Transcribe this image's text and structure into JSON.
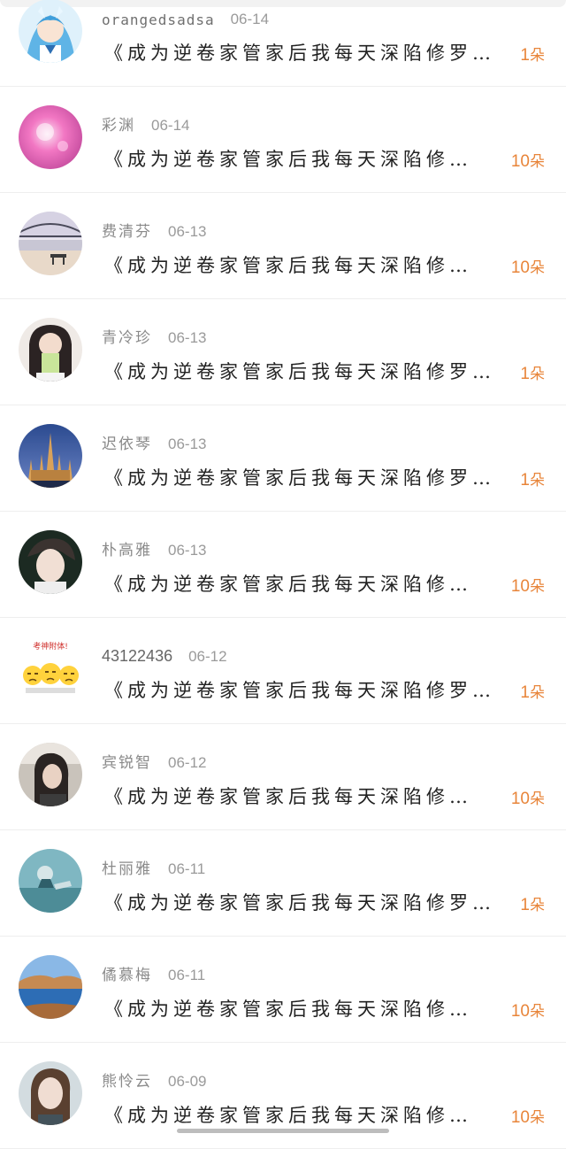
{
  "comments": [
    {
      "name": "orangedsadsa",
      "date": "06-14",
      "text": "《成为逆卷家管家后我每天深陷修罗…",
      "gift": "1",
      "unit": "朵"
    },
    {
      "name": "彩渊",
      "date": "06-14",
      "text": "《成为逆卷家管家后我每天深陷修…",
      "gift": "10",
      "unit": "朵"
    },
    {
      "name": "费清芬",
      "date": "06-13",
      "text": "《成为逆卷家管家后我每天深陷修…",
      "gift": "10",
      "unit": "朵"
    },
    {
      "name": "青冷珍",
      "date": "06-13",
      "text": "《成为逆卷家管家后我每天深陷修罗…",
      "gift": "1",
      "unit": "朵"
    },
    {
      "name": "迟依琴",
      "date": "06-13",
      "text": "《成为逆卷家管家后我每天深陷修罗…",
      "gift": "1",
      "unit": "朵"
    },
    {
      "name": "朴高雅",
      "date": "06-13",
      "text": "《成为逆卷家管家后我每天深陷修…",
      "gift": "10",
      "unit": "朵"
    },
    {
      "name": "43122436",
      "date": "06-12",
      "text": "《成为逆卷家管家后我每天深陷修罗…",
      "gift": "1",
      "unit": "朵",
      "avatar_caption": "考神附体!"
    },
    {
      "name": "宾锐智",
      "date": "06-12",
      "text": "《成为逆卷家管家后我每天深陷修…",
      "gift": "10",
      "unit": "朵"
    },
    {
      "name": "杜丽雅",
      "date": "06-11",
      "text": "《成为逆卷家管家后我每天深陷修罗…",
      "gift": "1",
      "unit": "朵"
    },
    {
      "name": "僪慕梅",
      "date": "06-11",
      "text": "《成为逆卷家管家后我每天深陷修…",
      "gift": "10",
      "unit": "朵"
    },
    {
      "name": "熊怜云",
      "date": "06-09",
      "text": "《成为逆卷家管家后我每天深陷修…",
      "gift": "10",
      "unit": "朵"
    }
  ]
}
